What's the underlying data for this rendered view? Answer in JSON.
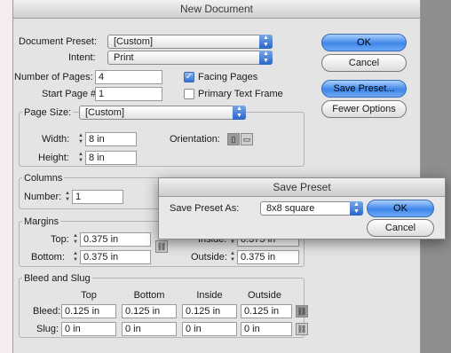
{
  "window": {
    "title": "New Document"
  },
  "document_preset": {
    "label": "Document Preset:",
    "value": "[Custom]"
  },
  "intent": {
    "label": "Intent:",
    "value": "Print"
  },
  "pages": {
    "number_label": "Number of Pages:",
    "number_value": "4",
    "start_label": "Start Page #:",
    "start_value": "1",
    "facing_label": "Facing Pages",
    "facing_checked": true,
    "primary_label": "Primary Text Frame",
    "primary_checked": false
  },
  "buttons": {
    "ok": "OK",
    "cancel": "Cancel",
    "save_preset": "Save Preset...",
    "fewer_options": "Fewer Options"
  },
  "page_size": {
    "label": "Page Size:",
    "value": "[Custom]",
    "width_label": "Width:",
    "width_value": "8 in",
    "height_label": "Height:",
    "height_value": "8 in",
    "orientation_label": "Orientation:"
  },
  "columns": {
    "group_label": "Columns",
    "number_label": "Number:",
    "number_value": "1"
  },
  "margins": {
    "group_label": "Margins",
    "top_label": "Top:",
    "top_value": "0.375 in",
    "bottom_label": "Bottom:",
    "bottom_value": "0.375 in",
    "inside_label": "Inside:",
    "inside_value": "0.375 in",
    "outside_label": "Outside:",
    "outside_value": "0.375 in"
  },
  "bleed_slug": {
    "group_label": "Bleed and Slug",
    "columns": [
      "Top",
      "Bottom",
      "Inside",
      "Outside"
    ],
    "bleed_label": "Bleed:",
    "bleed_values": [
      "0.125 in",
      "0.125 in",
      "0.125 in",
      "0.125 in"
    ],
    "slug_label": "Slug:",
    "slug_values": [
      "0 in",
      "0 in",
      "0 in",
      "0 in"
    ]
  },
  "save_preset_dialog": {
    "title": "Save Preset",
    "field_label": "Save Preset As:",
    "field_value": "8x8 square",
    "ok": "OK",
    "cancel": "Cancel"
  },
  "icons": {
    "stepper": "up-down-stepper-icon",
    "chain": "chain-link-icon",
    "portrait": "portrait-orientation-icon",
    "landscape": "landscape-orientation-icon",
    "select_arrow": "select-arrows-icon"
  },
  "colors": {
    "accent": "#3f86e8",
    "window_bg": "#e4e4e4",
    "page_bg": "#f6ecef"
  }
}
